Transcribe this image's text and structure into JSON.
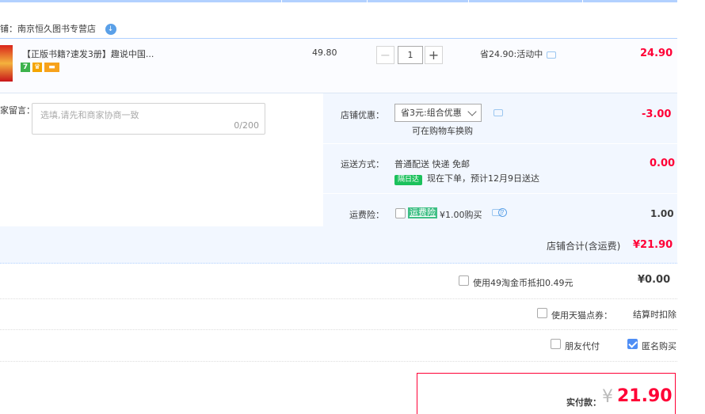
{
  "shop": {
    "name": "南京恒久图书专营店",
    "prefix_char": "铺：",
    "badge": "↓"
  },
  "item": {
    "title": "【正版书籍?速发3册】趣说中国...",
    "icons": [
      "seven-day-icon",
      "crown-icon",
      "card-icon"
    ],
    "icon_glyphs": {
      "seven": "7",
      "crown": "♛",
      "card": "▬"
    },
    "unit_price": "49.80",
    "qty_minus": "−",
    "qty": "1",
    "qty_plus": "+",
    "saving": "省24.90:活动中",
    "subtotal": "24.90"
  },
  "memo": {
    "label": "家留言：",
    "placeholder": "选填,请先和商家协商一致",
    "count": "0/200"
  },
  "coupon": {
    "label": "店铺优惠：",
    "selected": "省3元:组合优惠",
    "hint": "可在购物车换购",
    "amount": "-3.00"
  },
  "shipping": {
    "label": "运送方式：",
    "method": "普通配送 快递 免邮",
    "next_day_badge": "隔日达",
    "eta": "现在下单，预计12月9日送达",
    "amount": "0.00"
  },
  "insurance": {
    "label": "运费险：",
    "tag": "运费险",
    "price_text": "¥1.00购买",
    "help": "?",
    "amount": "1.00"
  },
  "shop_total": {
    "label": "店铺合计(含运费)",
    "value": "¥21.90"
  },
  "coins": {
    "label": "使用49淘金币抵扣0.49元",
    "value": "¥0.00"
  },
  "tmall_points": {
    "label": "使用天猫点券：",
    "value": "结算时扣除"
  },
  "friend_pay": {
    "label": "朋友代付"
  },
  "anonymous": {
    "label": "匿名购买",
    "checked": true
  },
  "payment": {
    "label": "实付款：",
    "currency": "¥",
    "total": "21.90"
  },
  "colors": {
    "accent": "#ff0036",
    "blue_line": "#b2d1ff",
    "panel_bg": "#f2f7ff",
    "checkbox_on": "#4f8ef5"
  }
}
